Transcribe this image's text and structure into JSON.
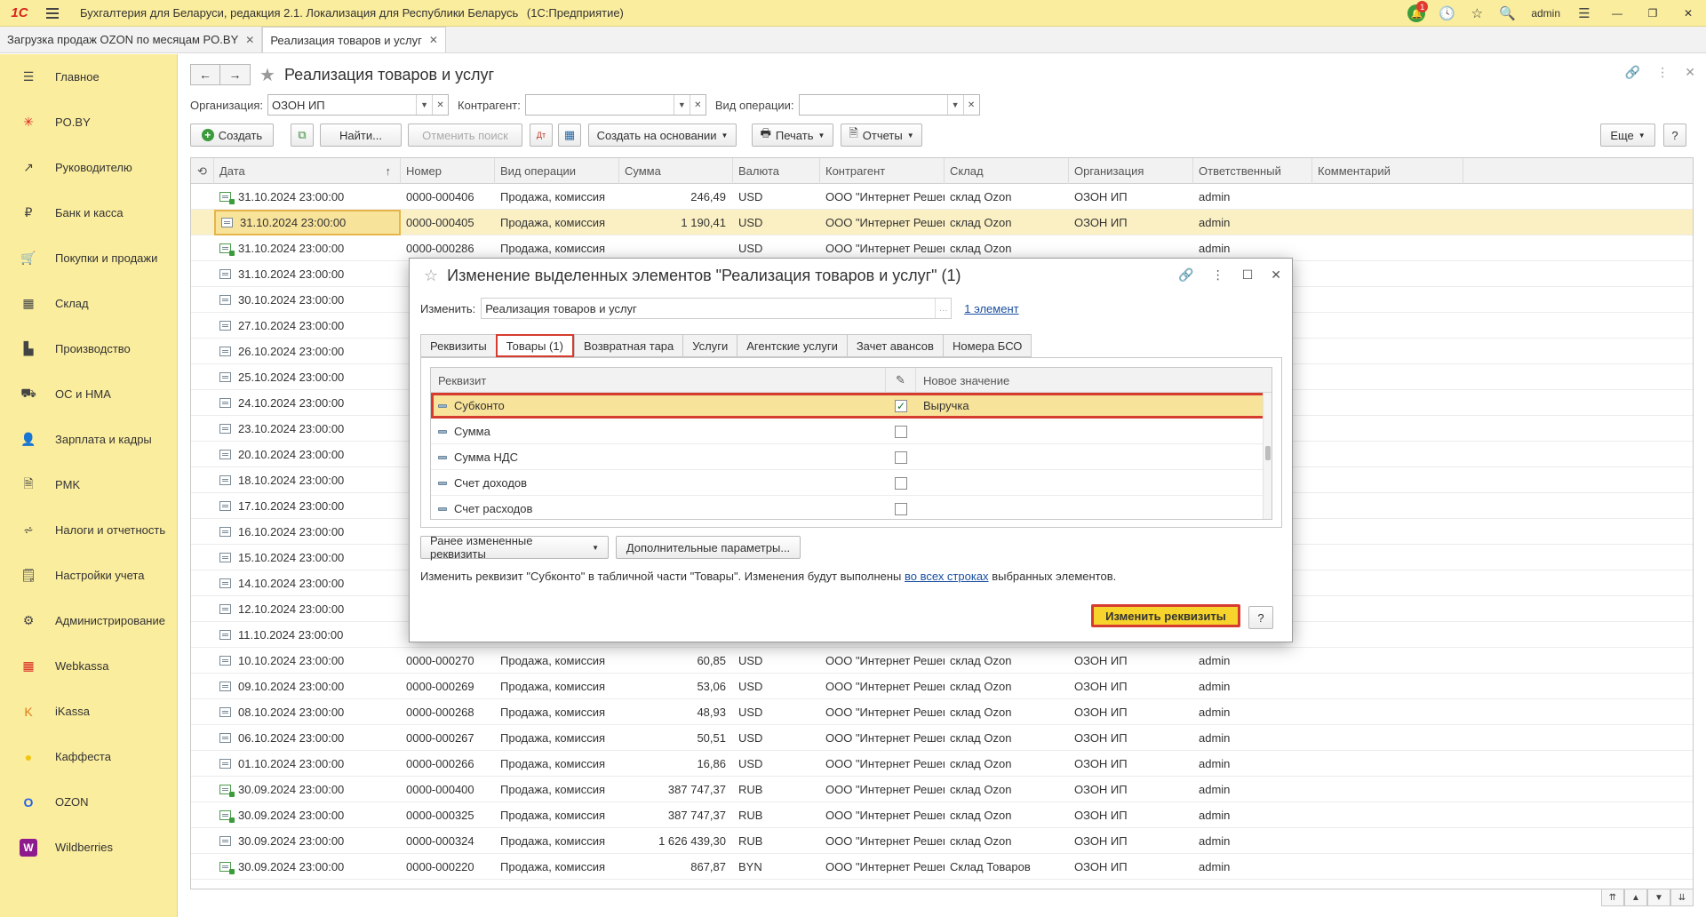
{
  "app": {
    "logo": "1С",
    "title": "Бухгалтерия для Беларуси, редакция 2.1. Локализация для Республики Беларусь",
    "platform": "(1С:Предприятие)",
    "user": "admin",
    "notifications": "1"
  },
  "open_tabs": [
    {
      "label": "Загрузка продаж OZON по месяцам PO.BY"
    },
    {
      "label": "Реализация товаров и услуг"
    }
  ],
  "sidebar": {
    "items": [
      {
        "label": "Главное",
        "icon": "menu-icon"
      },
      {
        "label": "PO.BY",
        "icon": "sparkle-icon"
      },
      {
        "label": "Руководителю",
        "icon": "chart-icon"
      },
      {
        "label": "Банк и касса",
        "icon": "ruble-icon"
      },
      {
        "label": "Покупки и продажи",
        "icon": "cart-icon"
      },
      {
        "label": "Склад",
        "icon": "warehouse-icon"
      },
      {
        "label": "Производство",
        "icon": "factory-icon"
      },
      {
        "label": "ОС и НМА",
        "icon": "truck-icon"
      },
      {
        "label": "Зарплата и кадры",
        "icon": "person-icon"
      },
      {
        "label": "PMK",
        "icon": "document-icon"
      },
      {
        "label": "Налоги и отчетность",
        "icon": "tax-icon"
      },
      {
        "label": "Настройки учета",
        "icon": "settings-doc-icon"
      },
      {
        "label": "Администрирование",
        "icon": "gear-icon"
      },
      {
        "label": "Webkassa",
        "icon": "grid-icon"
      },
      {
        "label": "iKassa",
        "icon": "k-icon"
      },
      {
        "label": "Каффеста",
        "icon": "circle-icon"
      },
      {
        "label": "OZON",
        "icon": "ozon-icon"
      },
      {
        "label": "Wildberries",
        "icon": "wb-icon"
      }
    ]
  },
  "page": {
    "title": "Реализация товаров и услуг",
    "filters": {
      "org_label": "Организация:",
      "org_value": "ОЗОН ИП",
      "contractor_label": "Контрагент:",
      "contractor_value": "",
      "operation_label": "Вид операции:",
      "operation_value": ""
    },
    "toolbar": {
      "create": "Создать",
      "find": "Найти...",
      "cancel_search": "Отменить поиск",
      "create_based": "Создать на основании",
      "print": "Печать",
      "reports": "Отчеты",
      "more": "Еще",
      "help": "?"
    }
  },
  "table": {
    "columns": [
      "Дата",
      "Номер",
      "Вид операции",
      "Сумма",
      "Валюта",
      "Контрагент",
      "Склад",
      "Организация",
      "Ответственный",
      "Комментарий"
    ],
    "rows": [
      {
        "date": "31.10.2024 23:00:00",
        "number": "0000-000406",
        "op": "Продажа, комиссия",
        "sum": "246,49",
        "cur": "USD",
        "contractor": "ООО \"Интернет Решен...",
        "store": "склад Ozon",
        "org": "ОЗОН ИП",
        "resp": "admin",
        "green": true
      },
      {
        "date": "31.10.2024 23:00:00",
        "number": "0000-000405",
        "op": "Продажа, комиссия",
        "sum": "1 190,41",
        "cur": "USD",
        "contractor": "ООО \"Интернет Решен...",
        "store": "склад Ozon",
        "org": "ОЗОН ИП",
        "resp": "admin",
        "green": false
      },
      {
        "date": "31.10.2024 23:00:00",
        "number": "0000-000286",
        "op": "Продажа, комиссия",
        "sum": "",
        "cur": "USD",
        "contractor": "ООО \"Интернет Решен...",
        "store": "склад Ozon",
        "org": "",
        "resp": "admin",
        "green": true
      },
      {
        "date": "31.10.2024 23:00:00",
        "number": "",
        "op": "",
        "sum": "",
        "cur": "",
        "contractor": "",
        "store": "",
        "org": "",
        "resp": "admin",
        "green": false
      },
      {
        "date": "30.10.2024 23:00:00",
        "number": "",
        "op": "",
        "sum": "",
        "cur": "",
        "contractor": "",
        "store": "",
        "org": "",
        "resp": "admin",
        "green": false
      },
      {
        "date": "27.10.2024 23:00:00",
        "number": "",
        "op": "",
        "sum": "",
        "cur": "",
        "contractor": "",
        "store": "",
        "org": "",
        "resp": "admin",
        "green": false
      },
      {
        "date": "26.10.2024 23:00:00",
        "number": "",
        "op": "",
        "sum": "",
        "cur": "",
        "contractor": "",
        "store": "",
        "org": "",
        "resp": "admin",
        "green": false
      },
      {
        "date": "25.10.2024 23:00:00",
        "number": "",
        "op": "",
        "sum": "",
        "cur": "",
        "contractor": "",
        "store": "",
        "org": "",
        "resp": "admin",
        "green": false
      },
      {
        "date": "24.10.2024 23:00:00",
        "number": "",
        "op": "",
        "sum": "",
        "cur": "",
        "contractor": "",
        "store": "",
        "org": "",
        "resp": "admin",
        "green": false
      },
      {
        "date": "23.10.2024 23:00:00",
        "number": "",
        "op": "",
        "sum": "",
        "cur": "",
        "contractor": "",
        "store": "",
        "org": "",
        "resp": "admin",
        "green": false
      },
      {
        "date": "20.10.2024 23:00:00",
        "number": "",
        "op": "",
        "sum": "",
        "cur": "",
        "contractor": "",
        "store": "",
        "org": "",
        "resp": "admin",
        "green": false
      },
      {
        "date": "18.10.2024 23:00:00",
        "number": "",
        "op": "",
        "sum": "",
        "cur": "",
        "contractor": "",
        "store": "",
        "org": "",
        "resp": "admin",
        "green": false
      },
      {
        "date": "17.10.2024 23:00:00",
        "number": "",
        "op": "",
        "sum": "",
        "cur": "",
        "contractor": "",
        "store": "",
        "org": "",
        "resp": "admin",
        "green": false
      },
      {
        "date": "16.10.2024 23:00:00",
        "number": "",
        "op": "",
        "sum": "",
        "cur": "",
        "contractor": "",
        "store": "",
        "org": "",
        "resp": "admin",
        "green": false
      },
      {
        "date": "15.10.2024 23:00:00",
        "number": "",
        "op": "",
        "sum": "",
        "cur": "",
        "contractor": "",
        "store": "",
        "org": "",
        "resp": "admin",
        "green": false
      },
      {
        "date": "14.10.2024 23:00:00",
        "number": "",
        "op": "",
        "sum": "",
        "cur": "",
        "contractor": "",
        "store": "",
        "org": "",
        "resp": "admin",
        "green": false
      },
      {
        "date": "12.10.2024 23:00:00",
        "number": "",
        "op": "",
        "sum": "",
        "cur": "",
        "contractor": "",
        "store": "",
        "org": "",
        "resp": "admin",
        "green": false
      },
      {
        "date": "11.10.2024 23:00:00",
        "number": "",
        "op": "",
        "sum": "",
        "cur": "",
        "contractor": "",
        "store": "",
        "org": "",
        "resp": "admin",
        "green": false
      },
      {
        "date": "10.10.2024 23:00:00",
        "number": "0000-000270",
        "op": "Продажа, комиссия",
        "sum": "60,85",
        "cur": "USD",
        "contractor": "ООО \"Интернет Решен...",
        "store": "склад Ozon",
        "org": "ОЗОН ИП",
        "resp": "admin",
        "green": false
      },
      {
        "date": "09.10.2024 23:00:00",
        "number": "0000-000269",
        "op": "Продажа, комиссия",
        "sum": "53,06",
        "cur": "USD",
        "contractor": "ООО \"Интернет Решен...",
        "store": "склад Ozon",
        "org": "ОЗОН ИП",
        "resp": "admin",
        "green": false
      },
      {
        "date": "08.10.2024 23:00:00",
        "number": "0000-000268",
        "op": "Продажа, комиссия",
        "sum": "48,93",
        "cur": "USD",
        "contractor": "ООО \"Интернет Решен...",
        "store": "склад Ozon",
        "org": "ОЗОН ИП",
        "resp": "admin",
        "green": false
      },
      {
        "date": "06.10.2024 23:00:00",
        "number": "0000-000267",
        "op": "Продажа, комиссия",
        "sum": "50,51",
        "cur": "USD",
        "contractor": "ООО \"Интернет Решен...",
        "store": "склад Ozon",
        "org": "ОЗОН ИП",
        "resp": "admin",
        "green": false
      },
      {
        "date": "01.10.2024 23:00:00",
        "number": "0000-000266",
        "op": "Продажа, комиссия",
        "sum": "16,86",
        "cur": "USD",
        "contractor": "ООО \"Интернет Решен...",
        "store": "склад Ozon",
        "org": "ОЗОН ИП",
        "resp": "admin",
        "green": false
      },
      {
        "date": "30.09.2024 23:00:00",
        "number": "0000-000400",
        "op": "Продажа, комиссия",
        "sum": "387 747,37",
        "cur": "RUB",
        "contractor": "ООО \"Интернет Решен...",
        "store": "склад Ozon",
        "org": "ОЗОН ИП",
        "resp": "admin",
        "green": true
      },
      {
        "date": "30.09.2024 23:00:00",
        "number": "0000-000325",
        "op": "Продажа, комиссия",
        "sum": "387 747,37",
        "cur": "RUB",
        "contractor": "ООО \"Интернет Решен...",
        "store": "склад Ozon",
        "org": "ОЗОН ИП",
        "resp": "admin",
        "green": true
      },
      {
        "date": "30.09.2024 23:00:00",
        "number": "0000-000324",
        "op": "Продажа, комиссия",
        "sum": "1 626 439,30",
        "cur": "RUB",
        "contractor": "ООО \"Интернет Решен...",
        "store": "склад Ozon",
        "org": "ОЗОН ИП",
        "resp": "admin",
        "green": false
      },
      {
        "date": "30.09.2024 23:00:00",
        "number": "0000-000220",
        "op": "Продажа, комиссия",
        "sum": "867,87",
        "cur": "BYN",
        "contractor": "ООО \"Интернет Решен...",
        "store": "Склад Товаров",
        "org": "ОЗОН ИП",
        "resp": "admin",
        "green": true
      }
    ]
  },
  "dialog": {
    "title": "Изменение выделенных элементов \"Реализация товаров и услуг\" (1)",
    "change_label": "Изменить:",
    "change_value": "Реализация товаров и услуг",
    "elements_link": "1 элемент",
    "tabs": [
      "Реквизиты",
      "Товары (1)",
      "Возвратная тара",
      "Услуги",
      "Агентские услуги",
      "Зачет авансов",
      "Номера БСО"
    ],
    "columns": {
      "attr": "Реквизит",
      "new_value": "Новое значение"
    },
    "rows": [
      {
        "name": "Субконто",
        "checked": true,
        "value": "Выручка"
      },
      {
        "name": "Сумма",
        "checked": false,
        "value": ""
      },
      {
        "name": "Сумма НДС",
        "checked": false,
        "value": ""
      },
      {
        "name": "Счет доходов",
        "checked": false,
        "value": ""
      },
      {
        "name": "Счет расходов",
        "checked": false,
        "value": ""
      }
    ],
    "prev_changed_btn": "Ранее измененные реквизиты",
    "extra_params_btn": "Дополнительные параметры...",
    "note_prefix": "Изменить реквизит \"Субконто\" в табличной части \"Товары\". Изменения будут выполнены",
    "note_link": "во всех строках",
    "note_suffix": "выбранных элементов.",
    "apply_btn": "Изменить реквизиты",
    "help_btn": "?"
  }
}
